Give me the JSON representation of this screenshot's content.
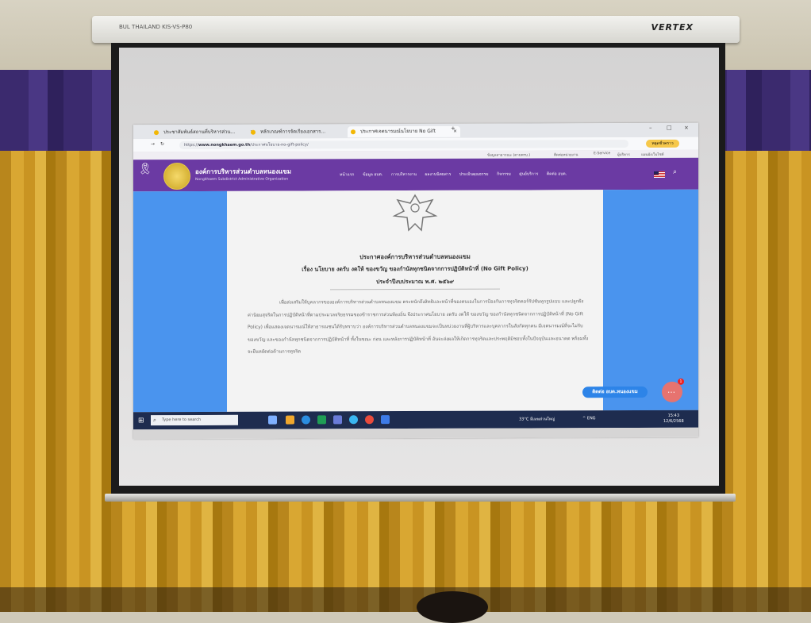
{
  "screen_case": {
    "label": "BUL THAILAND  KIS-VS-P80",
    "brand": "VERTEX"
  },
  "browser": {
    "tabs": [
      {
        "title": "ประชาสัมพันธ์สถานที่บริหารส่วน..."
      },
      {
        "title": "หลักเกณฑ์การจัดเรียงเอกสาร..."
      },
      {
        "title": "ประกาศเจตนารมณ์นโยบาย No Gift"
      }
    ],
    "url_prefix": "https://",
    "url_host": "www.nongkhaem.go.th",
    "url_path": "/ประกาศนโยบาย-no-gift-policy/",
    "profile": "หยุดชั่วคราว"
  },
  "site": {
    "top_links": [
      "ข้อมูลสาธารณะ (ตามพรบ.)",
      "ติดต่อหน่วยงาน",
      "E-Service",
      "ผู้บริหาร",
      "แผนผังเว็บไซต์"
    ],
    "org_name": "องค์การบริหารส่วนตำบลหนองแขม",
    "org_sub": "Nongkhaem Subdistrict Administrative Organization",
    "menu": [
      "หน้าแรก",
      "ข้อมูล อบต.",
      "การบริหารงาน",
      "ผลงานนิตยสาร",
      "ประเมินคุณธรรม",
      "กิจกรรม",
      "ศูนย์บริการ",
      "ติดต่อ อบต."
    ]
  },
  "document": {
    "heading": "ประกาศองค์การบริหารส่วนตำบลหนองแขม",
    "subject": "เรื่อง นโยบาย งดรับ งดให้ ของขวัญ ของกำนัลทุกชนิดจากการปฏิบัติหน้าที่ (No Gift Policy)",
    "fiscal_year": "ประจำปีงบประมาณ พ.ศ. ๒๕๖๙",
    "body": "เพื่อส่งเสริมให้บุคลากรขององค์การบริหารส่วนตำบลหนองแขม ตระหนักถึงสิทธิและหน้าที่ของตนเองในการป้องกันการทุจริตคอร์รัปชันทุกรูปแบบ และปลูกฝังค่านิยมสุจริตในการปฏิบัติหน้าที่ตามประมวลจริยธรรมของข้าราชการส่วนท้องถิ่น จึงประกาศนโยบาย งดรับ งดให้ ของขวัญ ของกำนัลทุกชนิดจากการปฏิบัติหน้าที่ (No Gift Policy) เพื่อแสดงเจตนารมณ์ให้สาธารณชนได้รับทราบว่า องค์การบริหารส่วนตำบลหนองแขมจะเป็นหน่วยงานที่ผู้บริหารและบุคลากรในสังกัดทุกคน มีเจตนารมณ์ที่จะไม่รับของขวัญ และของกำนัลทุกชนิดจากการปฏิบัติหน้าที่ ทั้งในขณะ ก่อน และหลังการปฏิบัติหน้าที่ อันจะส่งผลให้เกิดการทุจริตและประพฤติมิชอบทั้งในปัจจุบันและอนาคต พร้อมทั้งจะยืนหยัดต่อต้านการทุจริต",
    "chat_label": "ติดต่อ อบต.หนองแขม",
    "chat_badge": "1"
  },
  "taskbar": {
    "search_placeholder": "Type here to search",
    "weather": "33°C มีเมฆส่วนใหญ่",
    "tray": "^ ENG",
    "time": "15:43",
    "date": "12/6/2568"
  }
}
